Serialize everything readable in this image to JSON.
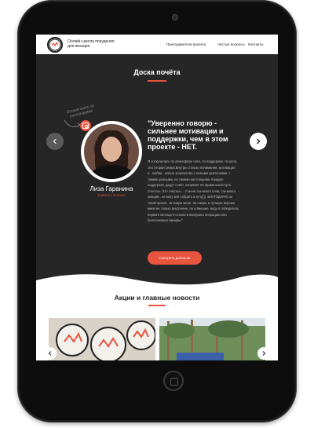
{
  "header": {
    "logo_text": "ПРО КАЧ SHOW",
    "tagline": "Онлайн школа похудения для женщин",
    "nav": [
      "Преподаватели проекта",
      "Частые вопросы",
      "Контакты"
    ]
  },
  "honor_board": {
    "title": "Доска почёта",
    "note": "Отзыв взят из инстаграма!",
    "person_name": "Лиза Гаранина",
    "person_meta": "2 место / 9 сезон",
    "quote": "\"Уверенно говорю - сильнее мотивации и поддержки, чем в этом проекте - НЕТ.",
    "body": "Я соскучилась по атмосфере чата, по поддержке, по уюту. Это вторая семья.Внутри столько понимания, мотивации и.. любви , новые знакомства с новыми девчонками, с такими разными, но такими настоящими. Каждую поддержат, дадут совет, направят на правильный путь. Счастье. Это счастье.... У меня так много слов, так много эмоций.. не могу всё собрать в кучу))). БЛАГОДАРЮ за такой проект, за новую меня. За новую и лучшую версию меня не только внутренне, но и внешне, ведь я победитель первого месяца 9 сезона и выиграла операцию или белоснежные виниры.\"",
    "button": "Смотреть до/после",
    "prev_icon": "chevron-left-icon",
    "next_icon": "chevron-right-icon"
  },
  "news": {
    "title": "Акции и главные новости",
    "prev_icon": "chevron-left-icon",
    "next_icon": "chevron-right-icon"
  },
  "colors": {
    "accent": "#e8543e",
    "dark": "#262626"
  }
}
